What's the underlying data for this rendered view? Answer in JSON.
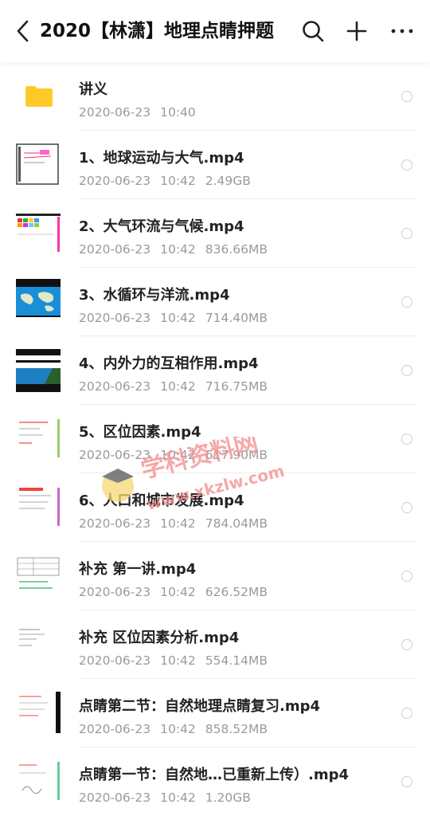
{
  "header": {
    "title": "2020【林潇】地理点睛押题",
    "back_icon": "chevron-left-icon",
    "search_icon": "search-icon",
    "add_icon": "plus-icon",
    "more_icon": "more-horizontal-icon"
  },
  "files": [
    {
      "name": "讲义",
      "date": "2020-06-23",
      "time": "10:40",
      "size": "",
      "type": "folder"
    },
    {
      "name": "1、地球运动与大气.mp4",
      "date": "2020-06-23",
      "time": "10:42",
      "size": "2.49GB",
      "type": "video"
    },
    {
      "name": "2、大气环流与气候.mp4",
      "date": "2020-06-23",
      "time": "10:42",
      "size": "836.66MB",
      "type": "video"
    },
    {
      "name": "3、水循环与洋流.mp4",
      "date": "2020-06-23",
      "time": "10:42",
      "size": "714.40MB",
      "type": "video"
    },
    {
      "name": "4、内外力的互相作用.mp4",
      "date": "2020-06-23",
      "time": "10:42",
      "size": "716.75MB",
      "type": "video"
    },
    {
      "name": "5、区位因素.mp4",
      "date": "2020-06-23",
      "time": "10:42",
      "size": "617.90MB",
      "type": "video"
    },
    {
      "name": "6、人口和城市发展.mp4",
      "date": "2020-06-23",
      "time": "10:42",
      "size": "784.04MB",
      "type": "video"
    },
    {
      "name": "补充 第一讲.mp4",
      "date": "2020-06-23",
      "time": "10:42",
      "size": "626.52MB",
      "type": "video"
    },
    {
      "name": "补充 区位因素分析.mp4",
      "date": "2020-06-23",
      "time": "10:42",
      "size": "554.14MB",
      "type": "video"
    },
    {
      "name": "点睛第二节：自然地理点睛复习.mp4",
      "date": "2020-06-23",
      "time": "10:42",
      "size": "858.52MB",
      "type": "video"
    },
    {
      "name": "点睛第一节：自然地…已重新上传）.mp4",
      "date": "2020-06-23",
      "time": "10:42",
      "size": "1.20GB",
      "type": "video"
    }
  ],
  "watermark": {
    "line1": "学科资料网",
    "line2": "www.xkzlw.com"
  },
  "colors": {
    "folder": "#FFC928",
    "meta": "#9a9a9a",
    "watermark": "#F28C8C"
  }
}
